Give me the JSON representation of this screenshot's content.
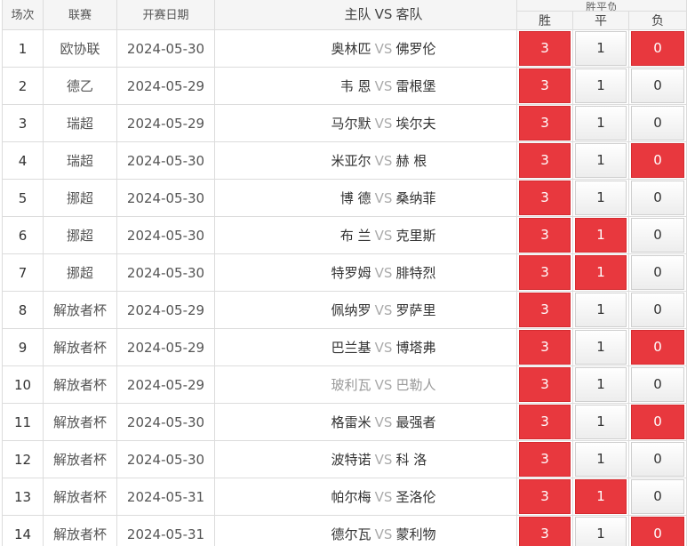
{
  "headers": {
    "index": "场次",
    "league": "联赛",
    "date": "开赛日期",
    "home": "主队",
    "vs": "VS",
    "away": "客队",
    "result_group": "胜平负",
    "win": "胜",
    "draw": "平",
    "lose": "负"
  },
  "colors": {
    "selected": "#e8383e",
    "header_bg": "#f5f5f5",
    "border": "#dcdcdc"
  },
  "rows": [
    {
      "no": "1",
      "league": "欧协联",
      "date": "2024-05-30",
      "home": "奥林匹",
      "away": "佛罗伦",
      "win": "3",
      "draw": "1",
      "lose": "0",
      "sel": [
        true,
        false,
        true
      ],
      "dim": false
    },
    {
      "no": "2",
      "league": "德乙",
      "date": "2024-05-29",
      "home": "韦 恩",
      "away": "雷根堡",
      "win": "3",
      "draw": "1",
      "lose": "0",
      "sel": [
        true,
        false,
        false
      ],
      "dim": false
    },
    {
      "no": "3",
      "league": "瑞超",
      "date": "2024-05-29",
      "home": "马尔默",
      "away": "埃尔夫",
      "win": "3",
      "draw": "1",
      "lose": "0",
      "sel": [
        true,
        false,
        false
      ],
      "dim": false
    },
    {
      "no": "4",
      "league": "瑞超",
      "date": "2024-05-30",
      "home": "米亚尔",
      "away": "赫 根",
      "win": "3",
      "draw": "1",
      "lose": "0",
      "sel": [
        true,
        false,
        true
      ],
      "dim": false
    },
    {
      "no": "5",
      "league": "挪超",
      "date": "2024-05-30",
      "home": "博 德",
      "away": "桑纳菲",
      "win": "3",
      "draw": "1",
      "lose": "0",
      "sel": [
        true,
        false,
        false
      ],
      "dim": false
    },
    {
      "no": "6",
      "league": "挪超",
      "date": "2024-05-30",
      "home": "布 兰",
      "away": "克里斯",
      "win": "3",
      "draw": "1",
      "lose": "0",
      "sel": [
        true,
        true,
        false
      ],
      "dim": false
    },
    {
      "no": "7",
      "league": "挪超",
      "date": "2024-05-30",
      "home": "特罗姆",
      "away": "腓特烈",
      "win": "3",
      "draw": "1",
      "lose": "0",
      "sel": [
        true,
        true,
        false
      ],
      "dim": false
    },
    {
      "no": "8",
      "league": "解放者杯",
      "date": "2024-05-29",
      "home": "佩纳罗",
      "away": "罗萨里",
      "win": "3",
      "draw": "1",
      "lose": "0",
      "sel": [
        true,
        false,
        false
      ],
      "dim": false
    },
    {
      "no": "9",
      "league": "解放者杯",
      "date": "2024-05-29",
      "home": "巴兰基",
      "away": "博塔弗",
      "win": "3",
      "draw": "1",
      "lose": "0",
      "sel": [
        true,
        false,
        true
      ],
      "dim": false
    },
    {
      "no": "10",
      "league": "解放者杯",
      "date": "2024-05-29",
      "home": "玻利瓦",
      "away": "巴勒人",
      "win": "3",
      "draw": "1",
      "lose": "0",
      "sel": [
        true,
        false,
        false
      ],
      "dim": true
    },
    {
      "no": "11",
      "league": "解放者杯",
      "date": "2024-05-30",
      "home": "格雷米",
      "away": "最强者",
      "win": "3",
      "draw": "1",
      "lose": "0",
      "sel": [
        true,
        false,
        true
      ],
      "dim": false
    },
    {
      "no": "12",
      "league": "解放者杯",
      "date": "2024-05-30",
      "home": "波特诺",
      "away": "科 洛",
      "win": "3",
      "draw": "1",
      "lose": "0",
      "sel": [
        true,
        false,
        false
      ],
      "dim": false
    },
    {
      "no": "13",
      "league": "解放者杯",
      "date": "2024-05-31",
      "home": "帕尔梅",
      "away": "圣洛伦",
      "win": "3",
      "draw": "1",
      "lose": "0",
      "sel": [
        true,
        true,
        false
      ],
      "dim": false
    },
    {
      "no": "14",
      "league": "解放者杯",
      "date": "2024-05-31",
      "home": "德尔瓦",
      "away": "蒙利物",
      "win": "3",
      "draw": "1",
      "lose": "0",
      "sel": [
        true,
        false,
        true
      ],
      "dim": false
    }
  ]
}
